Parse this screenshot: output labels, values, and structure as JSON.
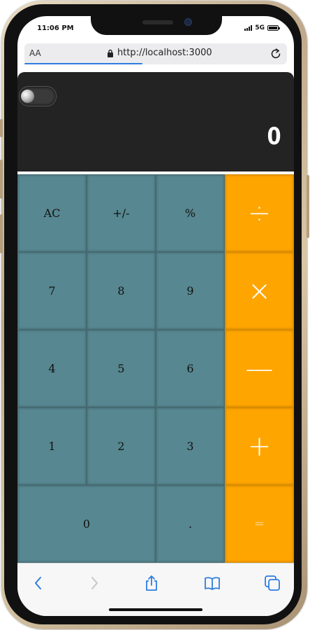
{
  "status_bar": {
    "time": "11:06 PM",
    "network": "5G"
  },
  "browser": {
    "text_size_label": "AA",
    "url": "http://localhost:3000",
    "load_progress_fraction": 0.45
  },
  "calculator": {
    "display_value": "0",
    "theme_toggle_on": false,
    "keys": {
      "ac": "AC",
      "sign": "+/-",
      "percent": "%",
      "divide": "÷",
      "seven": "7",
      "eight": "8",
      "nine": "9",
      "multiply": "×",
      "four": "4",
      "five": "5",
      "six": "6",
      "minus": "—",
      "one": "1",
      "two": "2",
      "three": "3",
      "plus": "+",
      "zero": "0",
      "decimal": ".",
      "equals": "="
    }
  },
  "colors": {
    "display_bg": "#232323",
    "key_bg": "#578790",
    "operator_bg": "#ffa500",
    "link_blue": "#2e7de0"
  },
  "toolbar": {
    "icons": [
      "back-icon",
      "forward-icon",
      "share-icon",
      "bookmarks-icon",
      "tabs-icon"
    ]
  }
}
